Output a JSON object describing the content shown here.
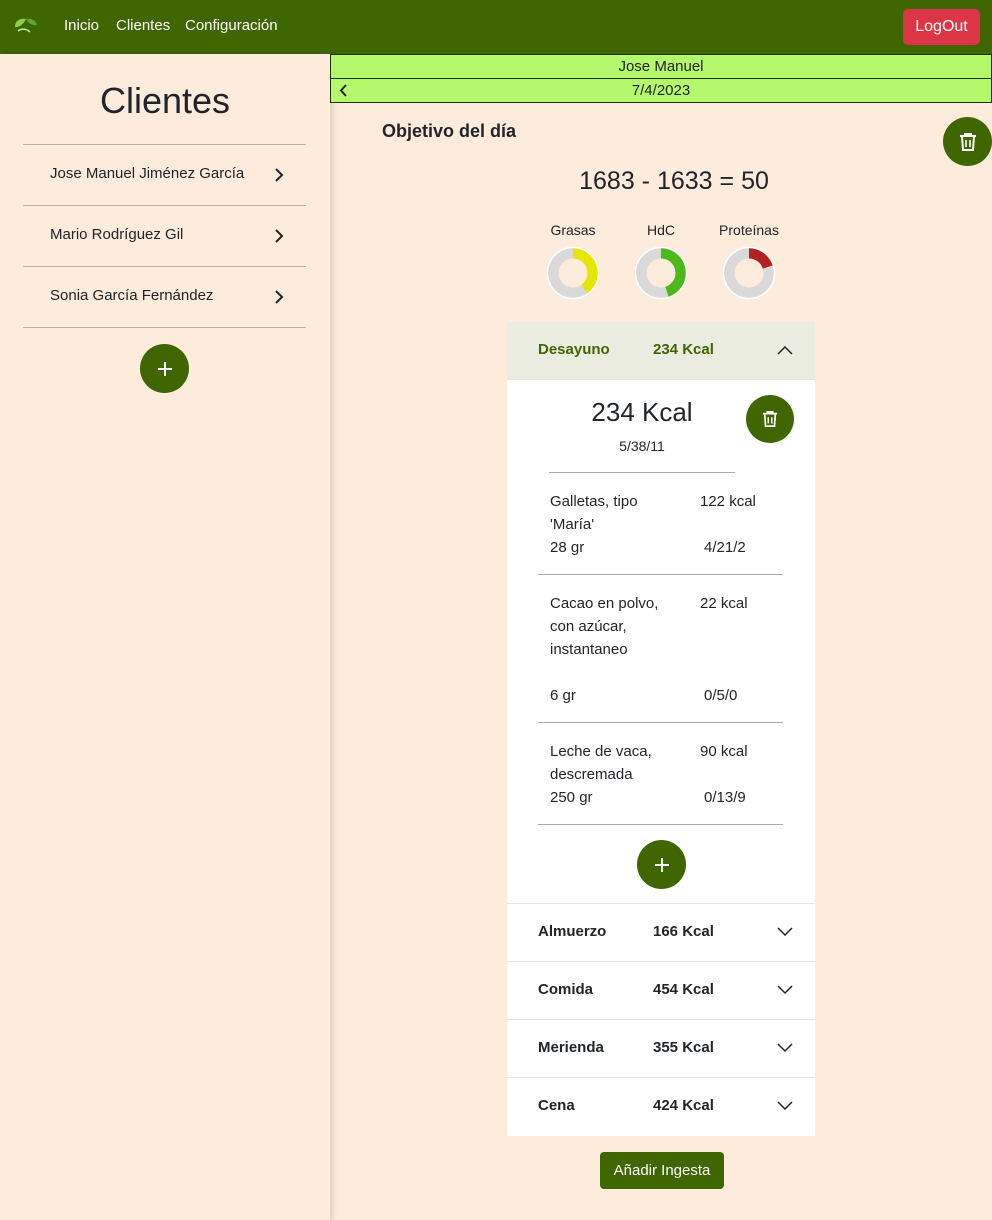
{
  "navbar": {
    "links": [
      "Inicio",
      "Clientes",
      "Configuración"
    ],
    "logout_label": "LogOut",
    "colors": {
      "primary": "#3f6600",
      "danger": "#dc3545",
      "highlight": "#b5f86b",
      "background": "#fdebdb"
    }
  },
  "sidebar": {
    "title": "Clientes",
    "clients": [
      {
        "name": "Jose Manuel Jiménez García"
      },
      {
        "name": "Mario Rodríguez Gil"
      },
      {
        "name": "Sonia García Fernández"
      }
    ],
    "add_icon": "plus-icon"
  },
  "main": {
    "client_name": "Jose Manuel",
    "date": "7/4/2023",
    "objetivo_title": "Objetivo del día",
    "equation": "1683 - 1633 = 50",
    "macros": [
      {
        "label": "Grasas",
        "fraction": 0.4,
        "color": "#e6e600"
      },
      {
        "label": "HdC",
        "fraction": 0.45,
        "color": "#4cb81c"
      },
      {
        "label": "Proteínas",
        "fraction": 0.2,
        "color": "#b22222"
      }
    ],
    "meals": [
      {
        "name": "Desayuno",
        "kcal": "234 Kcal",
        "open": true
      },
      {
        "name": "Almuerzo",
        "kcal": "166 Kcal"
      },
      {
        "name": "Comida",
        "kcal": "454 Kcal"
      },
      {
        "name": "Merienda",
        "kcal": "355 Kcal"
      },
      {
        "name": "Cena",
        "kcal": "424 Kcal"
      }
    ],
    "open_meal": {
      "total_kcal": "234 Kcal",
      "macros": "5/38/11",
      "foods": [
        {
          "name": "Galletas, tipo 'María'",
          "kcal": "122 kcal",
          "qty": "28 gr",
          "macros": "4/21/2"
        },
        {
          "name": "Cacao en polvo, con azúcar, instantaneo",
          "kcal": "22 kcal",
          "qty": "6 gr",
          "macros": "0/5/0"
        },
        {
          "name": "Leche de vaca, descremada",
          "kcal": "90 kcal",
          "qty": "250 gr",
          "macros": "0/13/9"
        }
      ]
    },
    "add_ingesta_label": "Añadir Ingesta"
  }
}
